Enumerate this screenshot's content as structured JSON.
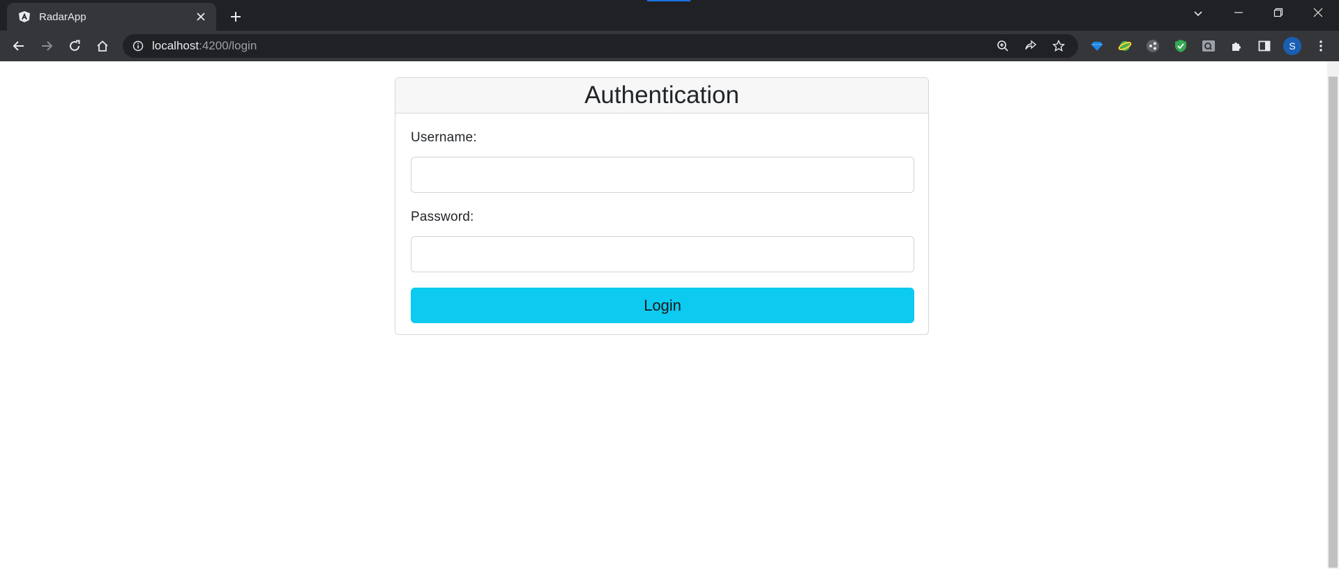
{
  "browser": {
    "tab_title": "RadarApp",
    "url_host": "localhost",
    "url_rest": ":4200/login",
    "avatar_initial": "S"
  },
  "page": {
    "card_title": "Authentication",
    "username_label": "Username:",
    "username_value": "",
    "password_label": "Password:",
    "password_value": "",
    "login_label": "Login"
  },
  "colors": {
    "login_button": "#0dcaf0",
    "card_header_bg": "#f7f7f7",
    "chrome_dark": "#202124",
    "chrome_toolbar": "#35363a"
  }
}
